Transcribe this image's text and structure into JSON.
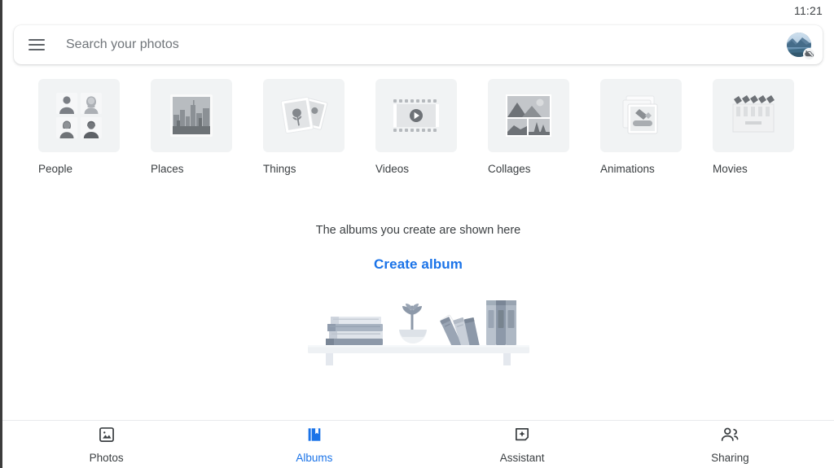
{
  "status": {
    "time": "11:21"
  },
  "search": {
    "placeholder": "Search your photos",
    "menu_icon": "hamburger-menu-icon",
    "avatar_icon": "account-avatar",
    "badge_icon": "backup-off-icon"
  },
  "categories": [
    {
      "label": "People",
      "icon": "people-faces-icon"
    },
    {
      "label": "Places",
      "icon": "cityscape-icon"
    },
    {
      "label": "Things",
      "icon": "photo-cards-flower-icon"
    },
    {
      "label": "Videos",
      "icon": "film-strip-play-icon"
    },
    {
      "label": "Collages",
      "icon": "collage-grid-icon"
    },
    {
      "label": "Animations",
      "icon": "stacked-photos-icon"
    },
    {
      "label": "Movies",
      "icon": "clapperboard-icon"
    }
  ],
  "empty_state": {
    "message": "The albums you create are shown here",
    "action_label": "Create album",
    "illustration": "bookshelf-illustration"
  },
  "bottom_nav": {
    "items": [
      {
        "label": "Photos",
        "icon": "photo-image-icon",
        "active": false
      },
      {
        "label": "Albums",
        "icon": "album-book-icon",
        "active": true
      },
      {
        "label": "Assistant",
        "icon": "assistant-sparkle-icon",
        "active": false
      },
      {
        "label": "Sharing",
        "icon": "people-share-icon",
        "active": false
      }
    ]
  },
  "colors": {
    "accent": "#1a73e8",
    "text": "#3c4043",
    "muted": "#70757a",
    "tile_bg": "#f1f3f4",
    "divider": "#e8eaed"
  }
}
